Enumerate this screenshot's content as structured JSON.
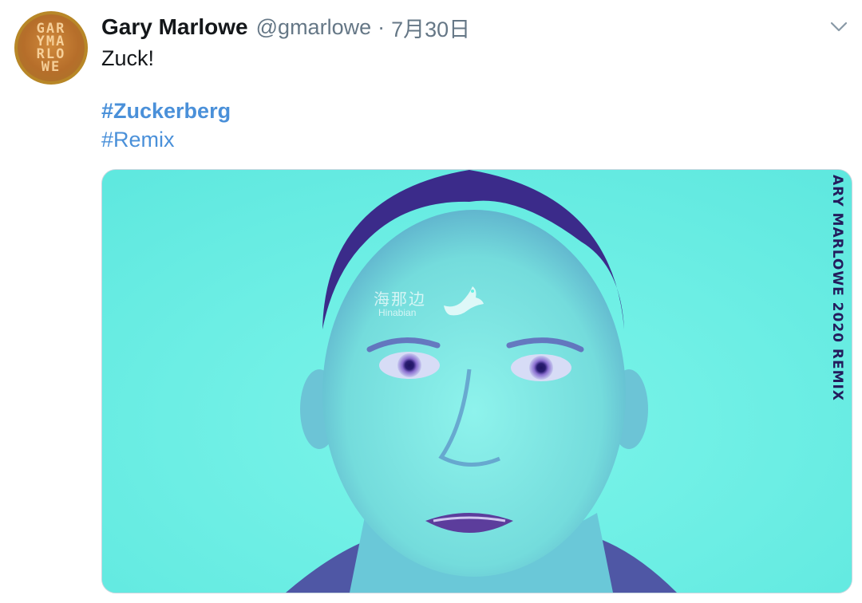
{
  "tweet": {
    "avatar": {
      "monogram_rows": [
        "GAR",
        "YMA",
        "RLO",
        "WE"
      ]
    },
    "author_name": "Gary Marlowe",
    "handle": "@gmarlowe",
    "separator": "·",
    "date": "7月30日",
    "menu_icon": "chevron-down-icon",
    "text": "Zuck!",
    "hashtags": [
      "#Zuckerberg",
      "#Remix"
    ],
    "media": {
      "overlay_text": "ARY MARLOWE 2020 REMIX",
      "watermark_cn": "海那边",
      "watermark_en": "Hinabian",
      "watermark_icon": "bird-icon"
    }
  },
  "colors": {
    "link": "#4a90d9",
    "muted": "#657786",
    "media_bg": "#66f0e4",
    "duotone_dark": "#3b2b8a"
  }
}
